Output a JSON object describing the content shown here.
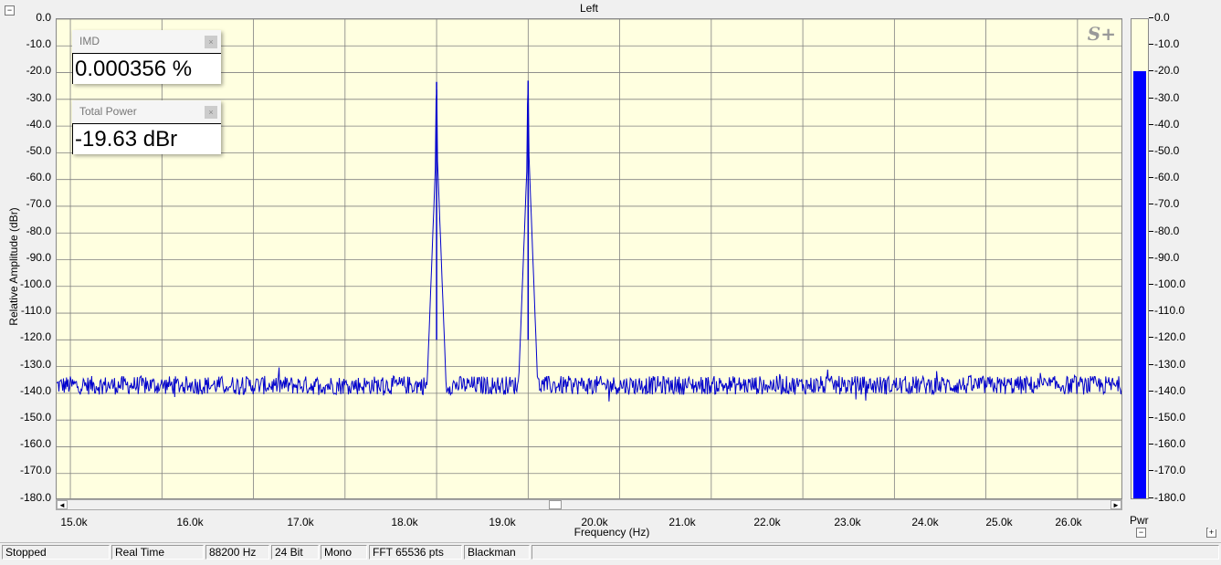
{
  "window": {
    "title": "Left",
    "collapse_glyph": "−"
  },
  "graph": {
    "y_axis_label": "Relative Amplitude (dBr)",
    "x_axis_label": "Frequency (Hz)",
    "y_ticks": [
      "0.0",
      "-10.0",
      "-20.0",
      "-30.0",
      "-40.0",
      "-50.0",
      "-60.0",
      "-70.0",
      "-80.0",
      "-90.0",
      "-100.0",
      "-110.0",
      "-120.0",
      "-130.0",
      "-140.0",
      "-150.0",
      "-160.0",
      "-170.0",
      "-180.0"
    ],
    "x_ticks": [
      "15.0k",
      "16.0k",
      "17.0k",
      "18.0k",
      "19.0k",
      "20.0k",
      "21.0k",
      "22.0k",
      "23.0k",
      "24.0k",
      "25.0k",
      "26.0k"
    ],
    "logo_text": "S+",
    "colors": {
      "background": "#ffffe0",
      "trace": "#0000cc",
      "grid": "#808080"
    }
  },
  "meters": {
    "imd": {
      "title": "IMD",
      "value": "0.000356 %",
      "close_glyph": "×"
    },
    "total_power": {
      "title": "Total Power",
      "value": "-19.63 dBr",
      "close_glyph": "×"
    }
  },
  "level_meter": {
    "label": "Pwr",
    "minus_glyph": "−",
    "plus_glyph": "+",
    "level_dbr": -19.63,
    "ticks": [
      "0.0",
      "-10.0",
      "-20.0",
      "-30.0",
      "-40.0",
      "-50.0",
      "-60.0",
      "-70.0",
      "-80.0",
      "-90.0",
      "-100.0",
      "-110.0",
      "-120.0",
      "-130.0",
      "-140.0",
      "-150.0",
      "-160.0",
      "-170.0",
      "-180.0"
    ],
    "fill_color": "#0000ff"
  },
  "scrollbar": {
    "left_arrow": "◄",
    "right_arrow": "►"
  },
  "status": {
    "state": "Stopped",
    "mode": "Real Time",
    "sample_rate": "88200 Hz",
    "bit_depth": "24 Bit",
    "channels": "Mono",
    "fft": "FFT 65536 pts",
    "window": "Blackman"
  },
  "chart_data": {
    "type": "line",
    "title": "Left",
    "xlabel": "Frequency (Hz)",
    "ylabel": "Relative Amplitude (dBr)",
    "xlim": [
      14850,
      26500
    ],
    "ylim": [
      -180,
      0
    ],
    "grid": true,
    "series": [
      {
        "noise_floor_dbr": -137,
        "peaks": [
          {
            "x": 19000,
            "y": -23.5
          },
          {
            "x": 20000,
            "y": -23
          }
        ]
      }
    ]
  }
}
